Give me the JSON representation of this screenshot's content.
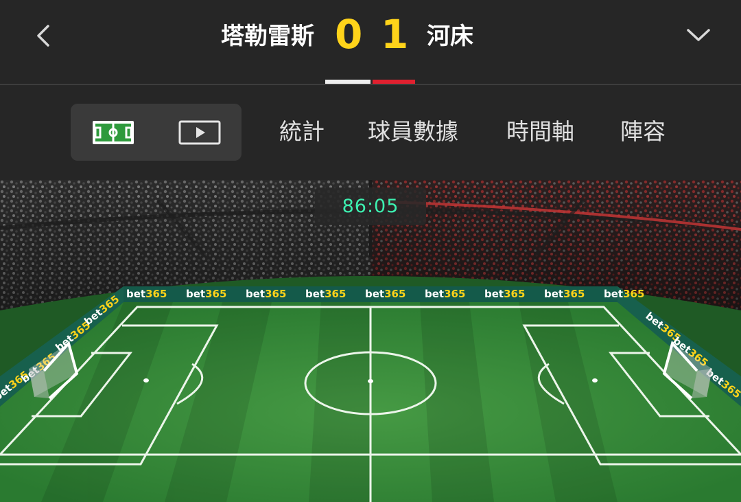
{
  "header": {
    "home_team": "塔勒雷斯",
    "away_team": "河床",
    "home_score": "0",
    "away_score": "1",
    "home_color": "#eeeeee",
    "away_color": "#e0202f",
    "score_color": "#ffd31a",
    "back_icon": "chevron-left-icon",
    "collapse_icon": "chevron-down-icon"
  },
  "tabs": {
    "view_toggle": {
      "field_icon": "pitch-icon",
      "video_icon": "play-video-icon"
    },
    "items": [
      {
        "label": "統計"
      },
      {
        "label": "球員數據"
      },
      {
        "label": "時間軸"
      },
      {
        "label": "陣容"
      }
    ]
  },
  "pitch": {
    "clock": "86:05",
    "clock_color": "#3df0b0",
    "sponsor": {
      "prefix": "bet",
      "suffix": "365"
    },
    "grass_color": "#2f8a35"
  }
}
